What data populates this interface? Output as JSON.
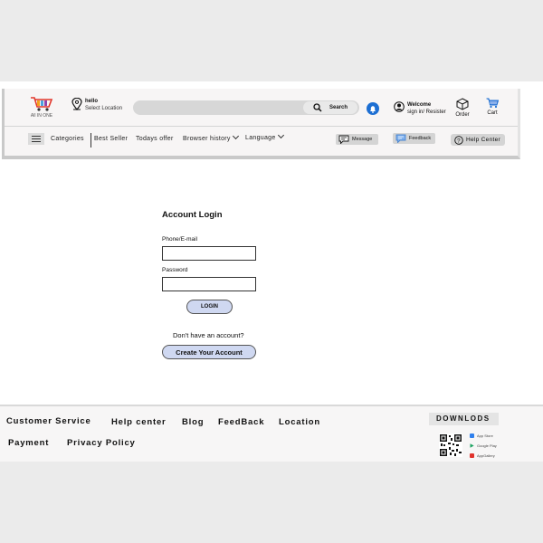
{
  "header": {
    "logo_text": "All IN ONE",
    "location": {
      "greeting": "hello",
      "label": "Select Location"
    },
    "search": {
      "button_label": "Search",
      "placeholder": ""
    },
    "account": {
      "welcome": "Welcome",
      "sign_in": "sign in/ Resister"
    },
    "order_label": "Order",
    "cart_label": "Cart"
  },
  "nav": {
    "categories": "Categories",
    "best_seller": "Best Seller",
    "todays_offer": "Todays offer",
    "browser_history": "Browser history",
    "language": "Language",
    "message": "Message",
    "feedback": "Feedback",
    "help_center": "Help Center"
  },
  "login": {
    "title": "Account Login",
    "phone_label": "Phone/E-mail",
    "phone_value": "",
    "password_label": "Password",
    "password_value": "",
    "login_button": "LOGIN",
    "no_account": "Don't have an account?",
    "create_button": "Create Your Account"
  },
  "footer": {
    "links_row1": [
      "Customer Service",
      "Help center",
      "Blog",
      "FeedBack",
      "Location"
    ],
    "links_row2": [
      "Payment",
      "Privacy Policy"
    ],
    "downloads_title": "DOWNLODS",
    "stores": [
      "App Store",
      "Google Play",
      "AppGallery"
    ]
  },
  "colors": {
    "accent_button": "#cfd8f1",
    "bell": "#1d6fd3",
    "cart": "#1d6fd3"
  }
}
